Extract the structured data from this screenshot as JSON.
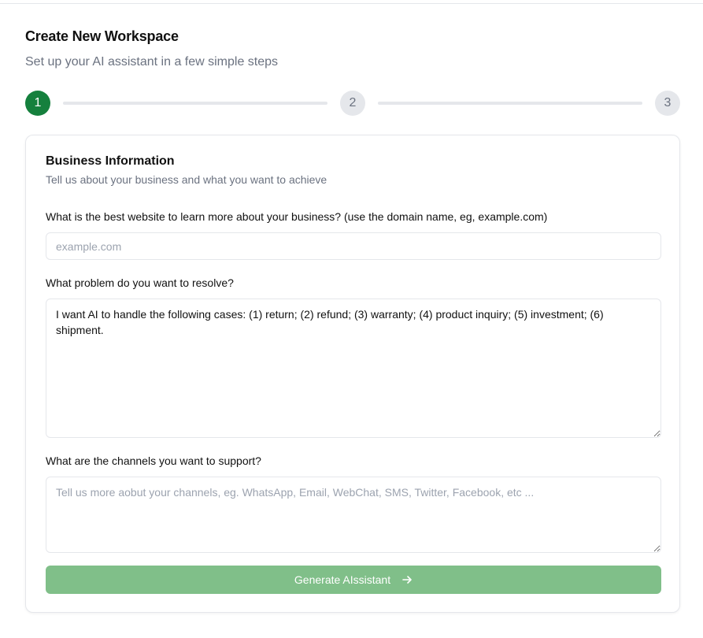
{
  "header": {
    "title": "Create New Workspace",
    "subtitle": "Set up your AI assistant in a few simple steps"
  },
  "stepper": {
    "steps": [
      "1",
      "2",
      "3"
    ],
    "active_step": 1,
    "colors": {
      "active": "#15803d",
      "inactive": "#e5e7eb"
    }
  },
  "card": {
    "title": "Business Information",
    "description": "Tell us about your business and what you want to achieve",
    "website": {
      "label": "What is the best website to learn more about your business? (use the domain name, eg, example.com)",
      "placeholder": "example.com",
      "value": ""
    },
    "problem": {
      "label": "What problem do you want to resolve?",
      "value": "I want AI to handle the following cases: (1) return; (2) refund; (3) warranty; (4) product inquiry; (5) investment; (6) shipment."
    },
    "channels": {
      "label": "What are the channels you want to support?",
      "placeholder": "Tell us more aobut your channels, eg. WhatsApp, Email, WebChat, SMS, Twitter, Facebook, etc ...",
      "value": ""
    },
    "submit": {
      "label": "Generate AIssistant",
      "icon": "arrow-right-icon",
      "color": "#80bf89"
    }
  }
}
